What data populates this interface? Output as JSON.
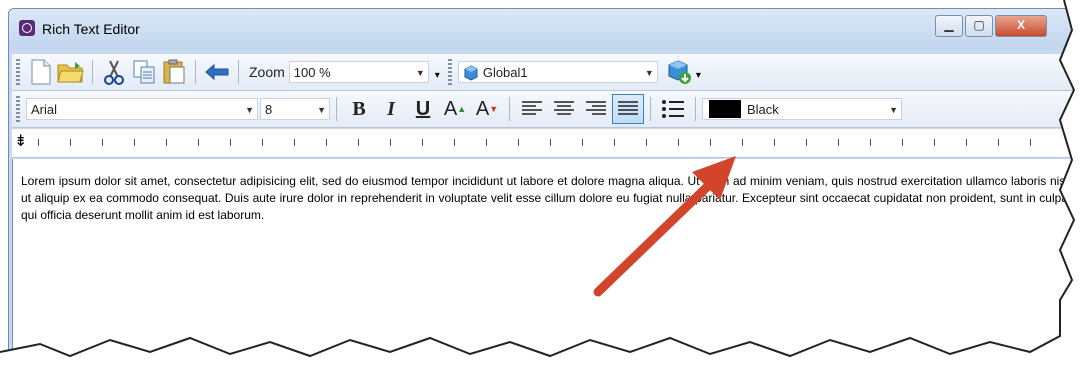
{
  "window": {
    "title": "Rich Text Editor",
    "controls": {
      "minimize": "▁",
      "maximize": "▢",
      "close": "X"
    }
  },
  "toolbar1": {
    "zoom_label": "Zoom",
    "zoom_value": "100 %",
    "scope_value": "Global1"
  },
  "toolbar2": {
    "font_name": "Arial",
    "font_size": "8",
    "bold": "B",
    "italic": "I",
    "underline": "U",
    "grow_font": "A",
    "shrink_font": "A",
    "color_name": "Black"
  },
  "editor": {
    "text": "Lorem ipsum dolor sit amet, consectetur adipisicing elit, sed do eiusmod tempor incididunt ut labore et dolore magna aliqua. Ut enim ad minim veniam, quis nostrud exercitation ullamco laboris nisi ut aliquip ex ea commodo consequat. Duis aute irure dolor in reprehenderit in voluptate velit esse cillum dolore eu fugiat nulla pariatur. Excepteur sint occaecat cupidatat non proident, sunt in culpa qui officia deserunt mollit anim id est laborum."
  },
  "colors": {
    "annotation_arrow": "#d2452c",
    "active_button": "#3c7fb1"
  }
}
